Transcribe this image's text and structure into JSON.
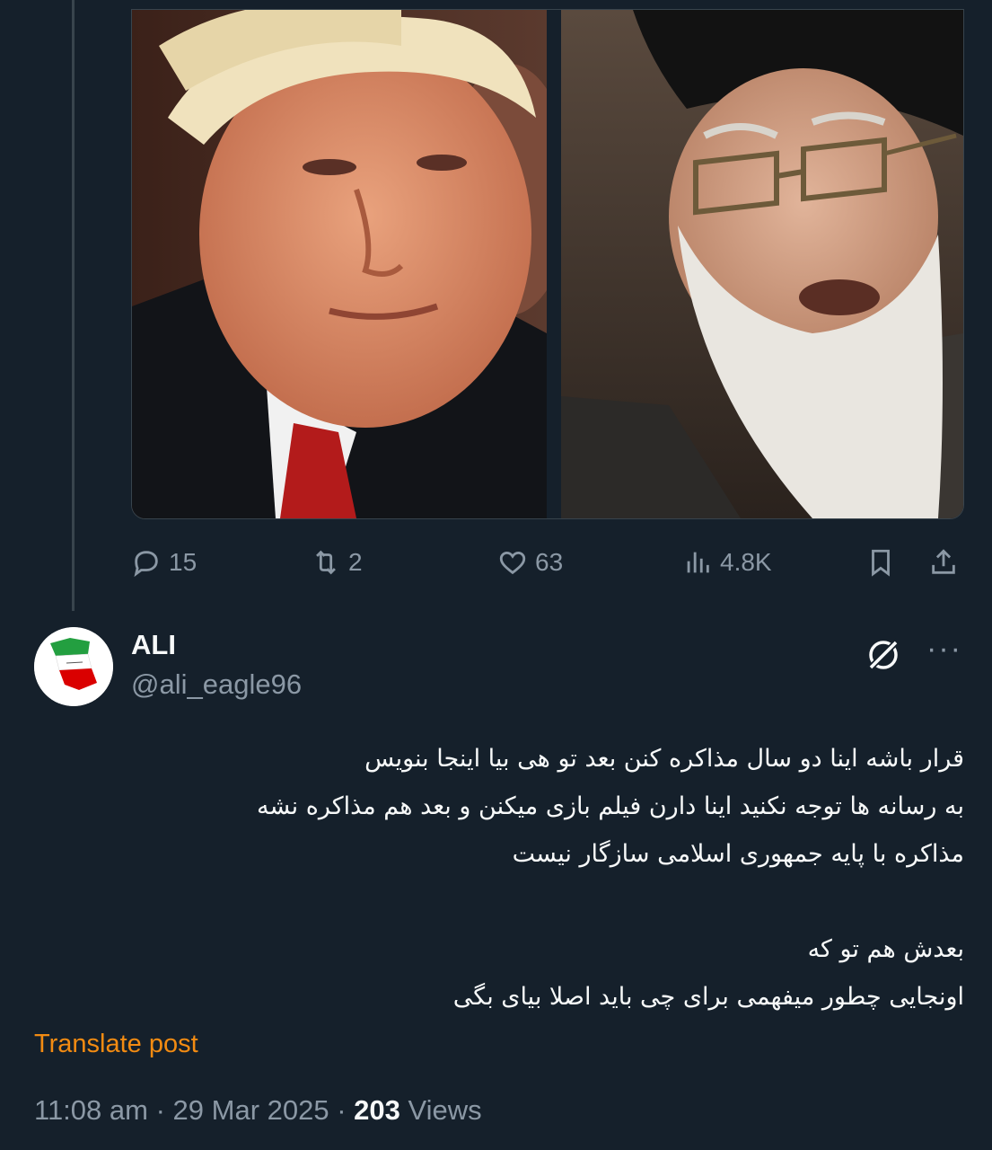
{
  "post_actions": {
    "replies": "15",
    "reposts": "2",
    "likes": "63",
    "views": "4.8K"
  },
  "reply": {
    "author_name": "ALI",
    "author_handle": "@ali_eagle96",
    "more_label": "···",
    "body_lines": [
      "قرار باشه اینا دو سال مذاکره کنن بعد تو هی بیا اینجا بنویس",
      "به رسانه ها توجه نکنید اینا دارن فیلم بازی میکنن و بعد هم مذاکره نشه",
      "مذاکره با پایه جمهوری اسلامی سازگار نیست",
      "",
      "بعدش هم تو که",
      "اونجایی چطور میفهمی برای چی باید اصلا بیای بگی"
    ],
    "translate_label": "Translate post",
    "time": "11:08 am",
    "separator": "·",
    "date": "29 Mar 2025",
    "views_count": "203",
    "views_label": "Views"
  },
  "colors": {
    "background": "#15202b",
    "text": "#f7f9f9",
    "muted": "#8b98a5",
    "translate": "#f28b12",
    "border": "#38444d"
  },
  "icons": [
    "reply-icon",
    "repost-icon",
    "like-icon",
    "views-icon",
    "bookmark-icon",
    "share-icon",
    "grok-icon",
    "more-icon"
  ]
}
